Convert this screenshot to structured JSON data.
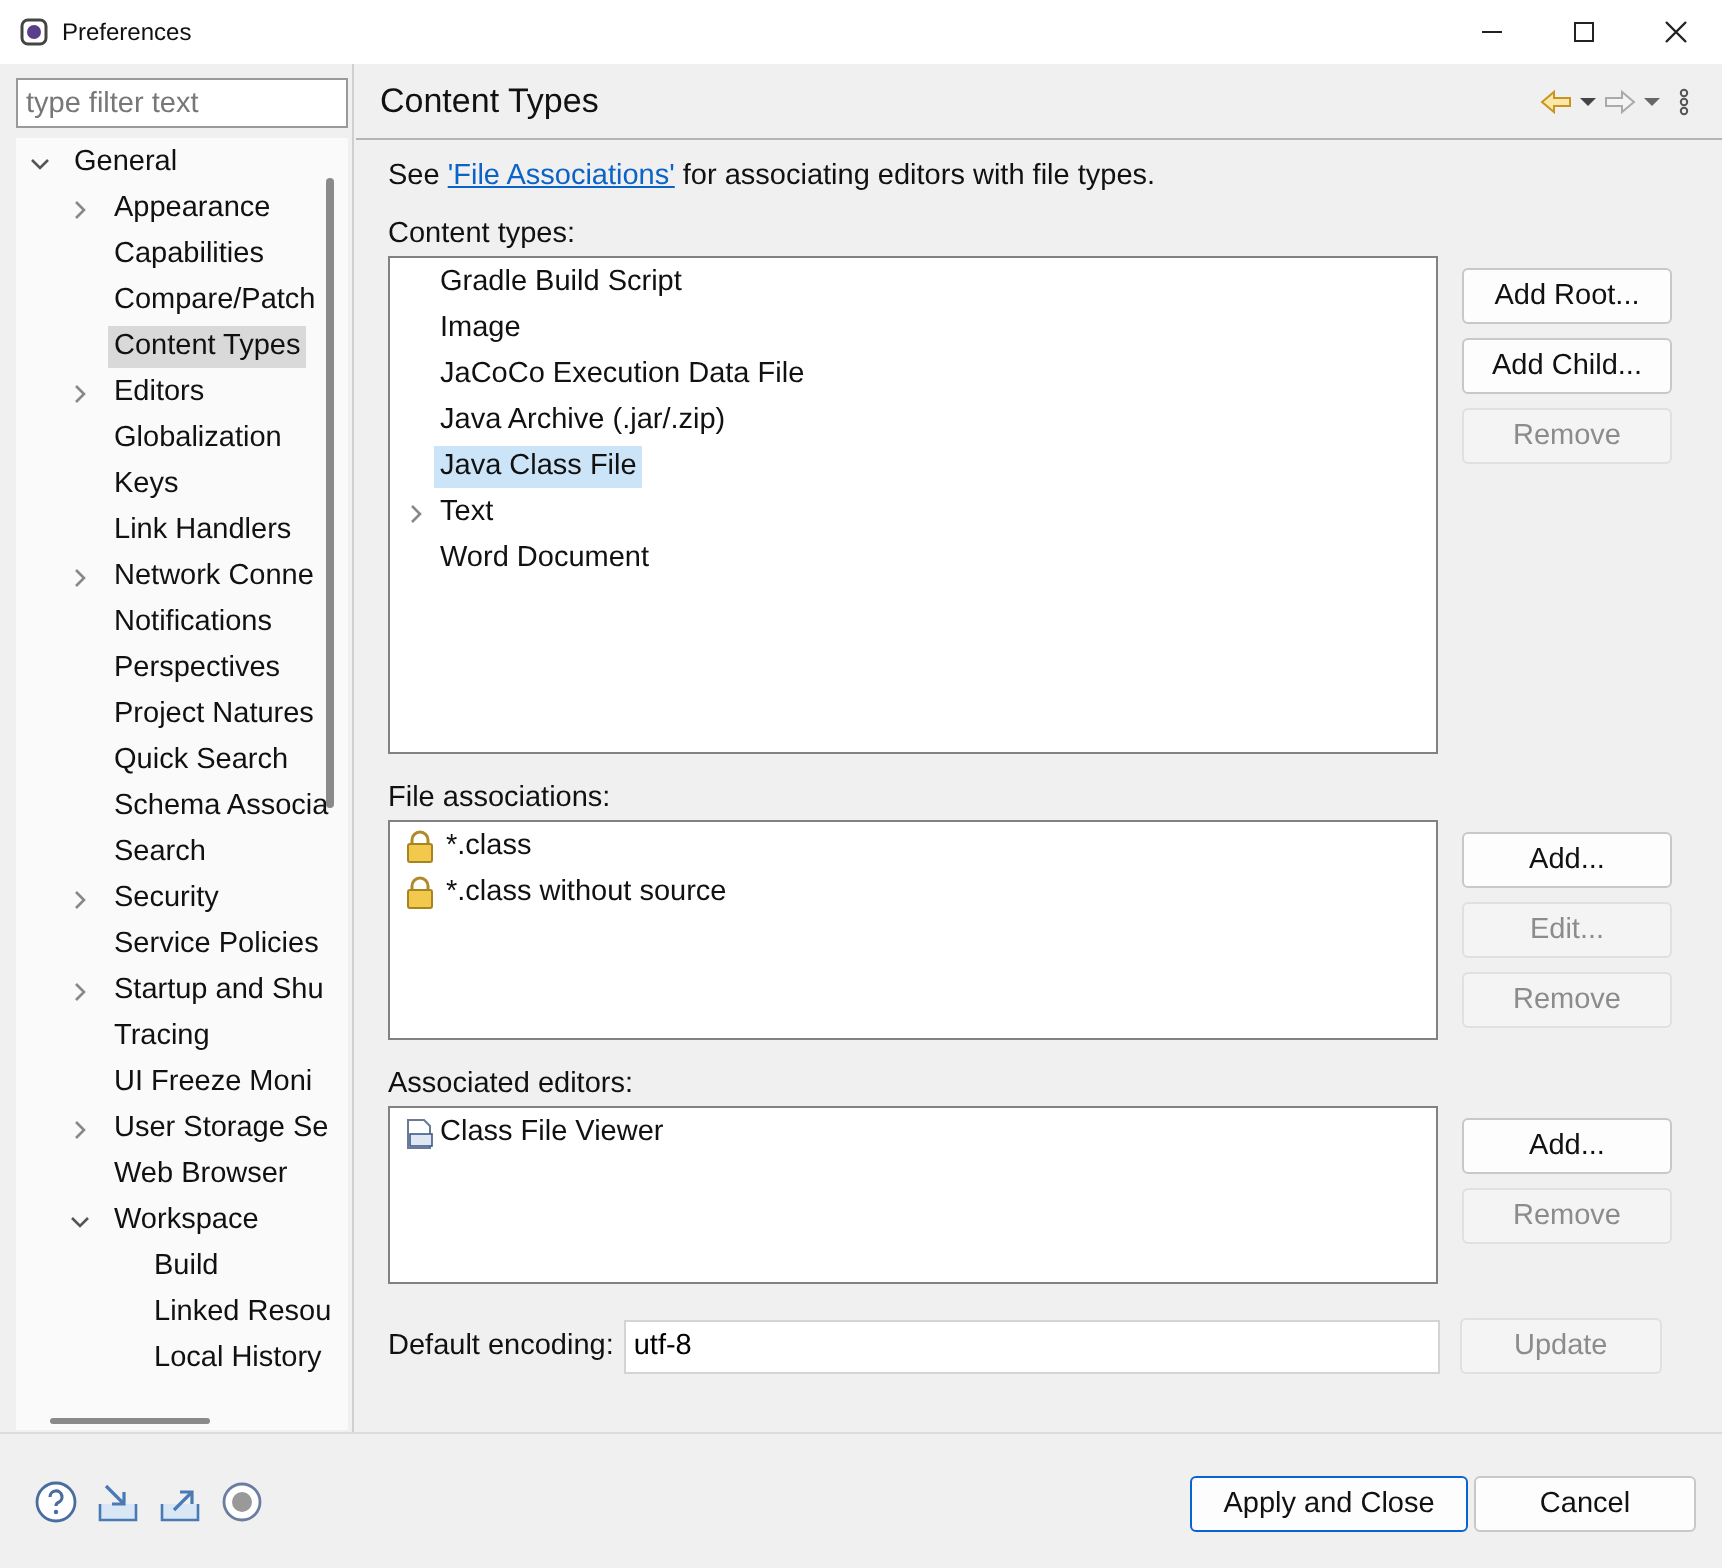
{
  "window": {
    "title": "Preferences"
  },
  "filter": {
    "placeholder": "type filter text"
  },
  "tree": [
    {
      "label": "General",
      "expanded": true,
      "selected": false,
      "children": [
        {
          "label": "Appearance",
          "expanded": false,
          "selected": false
        },
        {
          "label": "Capabilities",
          "selected": false
        },
        {
          "label": "Compare/Patch",
          "selected": false
        },
        {
          "label": "Content Types",
          "selected": true
        },
        {
          "label": "Editors",
          "expanded": false,
          "selected": false
        },
        {
          "label": "Globalization",
          "selected": false
        },
        {
          "label": "Keys",
          "selected": false
        },
        {
          "label": "Link Handlers",
          "selected": false
        },
        {
          "label": "Network Conne",
          "expanded": false,
          "selected": false
        },
        {
          "label": "Notifications",
          "selected": false
        },
        {
          "label": "Perspectives",
          "selected": false
        },
        {
          "label": "Project Natures",
          "selected": false
        },
        {
          "label": "Quick Search",
          "selected": false
        },
        {
          "label": "Schema Associa",
          "selected": false
        },
        {
          "label": "Search",
          "selected": false
        },
        {
          "label": "Security",
          "expanded": false,
          "selected": false
        },
        {
          "label": "Service Policies",
          "selected": false
        },
        {
          "label": "Startup and Shu",
          "expanded": false,
          "selected": false
        },
        {
          "label": "Tracing",
          "selected": false
        },
        {
          "label": "UI Freeze Moni",
          "selected": false
        },
        {
          "label": "User Storage Se",
          "expanded": false,
          "selected": false
        },
        {
          "label": "Web Browser",
          "selected": false
        },
        {
          "label": "Workspace",
          "expanded": true,
          "selected": false,
          "children": [
            {
              "label": "Build",
              "selected": false
            },
            {
              "label": "Linked Resou",
              "selected": false
            },
            {
              "label": "Local History",
              "selected": false
            }
          ]
        }
      ]
    }
  ],
  "page": {
    "title": "Content Types",
    "intro": {
      "before": "See ",
      "link": "'File Associations'",
      "after": " for associating editors with file types."
    },
    "sections": [
      {
        "label": "Content types:",
        "kind": "tree",
        "items": [
          {
            "label": "Gradle Build Script",
            "selected": false
          },
          {
            "label": "Image",
            "selected": false
          },
          {
            "label": "JaCoCo Execution Data File",
            "selected": false
          },
          {
            "label": "Java Archive (.jar/.zip)",
            "selected": false
          },
          {
            "label": "Java Class File",
            "selected": true
          },
          {
            "label": "Text",
            "selected": false,
            "expanded": false
          },
          {
            "label": "Word Document",
            "selected": false
          }
        ],
        "buttons": [
          {
            "label": "Add Root...",
            "disabled": false
          },
          {
            "label": "Add Child...",
            "disabled": false
          },
          {
            "label": "Remove",
            "disabled": true
          }
        ]
      },
      {
        "label": "File associations:",
        "kind": "locked",
        "items": [
          {
            "label": "*.class",
            "selected": false
          },
          {
            "label": "*.class without source",
            "selected": false
          }
        ],
        "buttons": [
          {
            "label": "Add...",
            "disabled": false
          },
          {
            "label": "Edit...",
            "disabled": true
          },
          {
            "label": "Remove",
            "disabled": true
          }
        ]
      },
      {
        "label": "Associated editors:",
        "kind": "editor",
        "items": [
          {
            "label": "Class File Viewer",
            "selected": false
          }
        ],
        "buttons": [
          {
            "label": "Add...",
            "disabled": false
          },
          {
            "label": "Remove",
            "disabled": true
          }
        ]
      }
    ],
    "encoding": {
      "label": "Default encoding:",
      "value": "utf-8",
      "button": {
        "label": "Update",
        "disabled": true
      }
    }
  },
  "footer": {
    "buttons": [
      {
        "label": "Apply and Close",
        "default": true
      },
      {
        "label": "Cancel",
        "default": false
      }
    ]
  }
}
